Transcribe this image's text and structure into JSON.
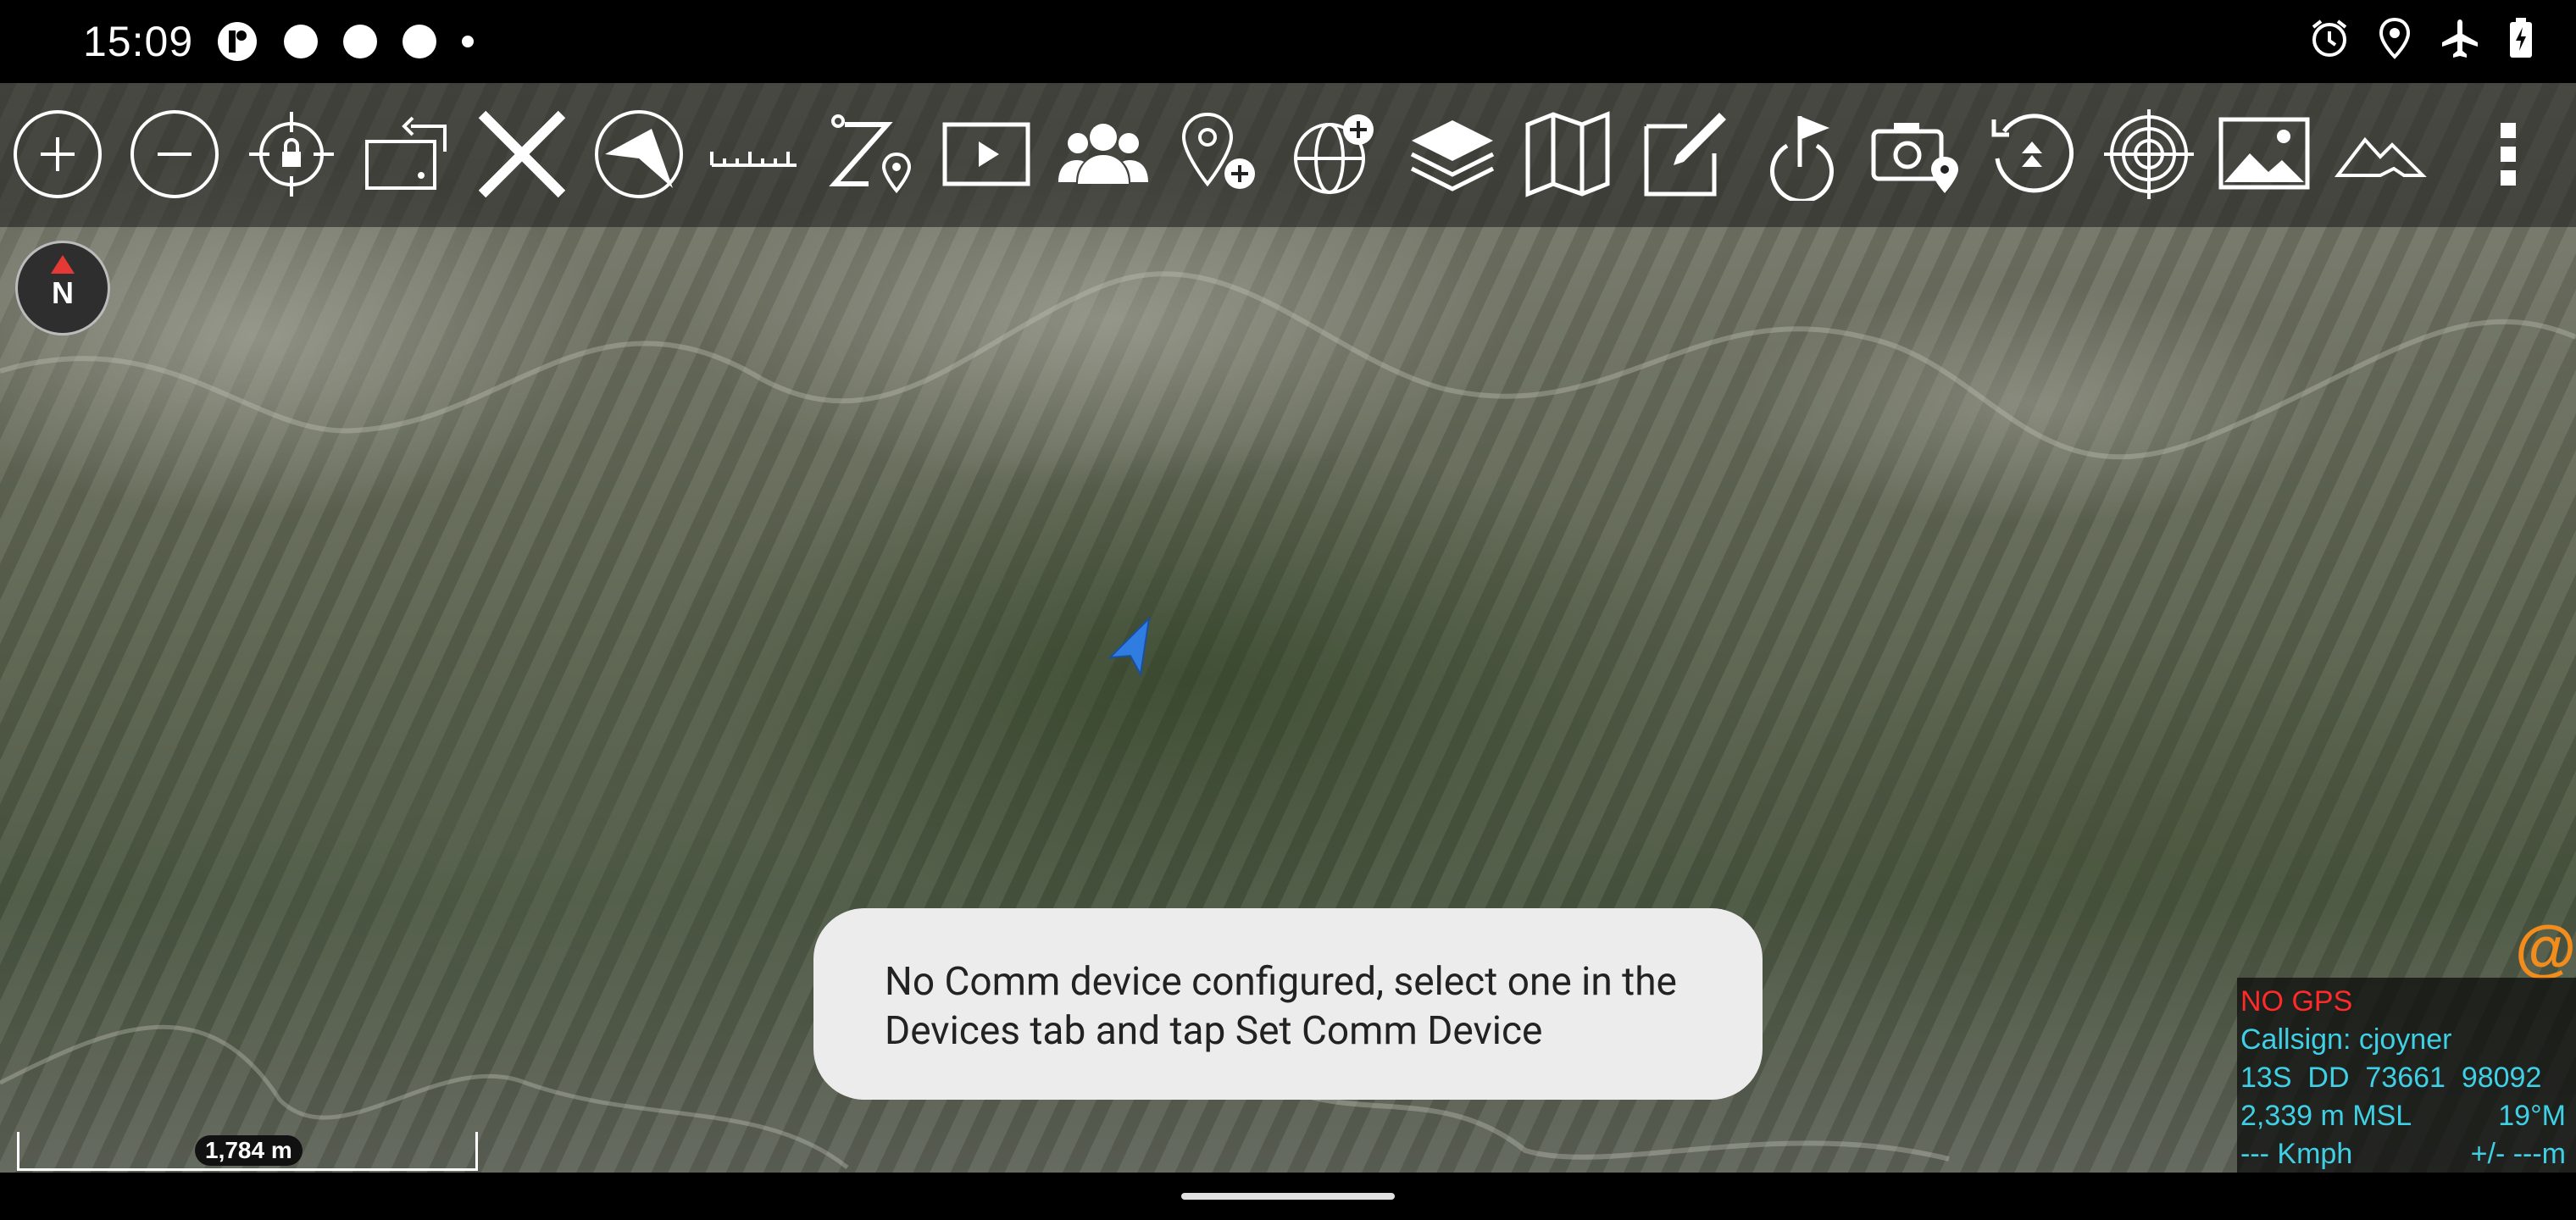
{
  "status_bar": {
    "time": "15:09",
    "left_icons": [
      "app-notification-icon",
      "circle-icon",
      "circle-icon",
      "circle-icon",
      "more-dot-icon"
    ],
    "right_icons": [
      "alarm-icon",
      "location-icon",
      "airplane-icon",
      "battery-charging-icon"
    ]
  },
  "toolbar": {
    "tools": [
      "zoom-in-icon",
      "zoom-out-icon",
      "lock-on-self-icon",
      "rotate-map-icon",
      "x-mark-icon",
      "compass-rose-icon",
      "measure-ruler-icon",
      "route-icon",
      "video-player-icon",
      "contacts-group-icon",
      "add-point-icon",
      "add-overlay-globe-icon",
      "layers-icon",
      "map-icon",
      "edit-note-icon",
      "checkpoint-flag-icon",
      "geotag-camera-icon",
      "track-history-icon",
      "target-icon",
      "image-gallery-icon",
      "terrain-icon",
      "overflow-menu-icon"
    ]
  },
  "compass": {
    "label": "N"
  },
  "toast": {
    "message": "No Comm device configured, select one in the Devices tab and tap Set Comm Device"
  },
  "info_panel": {
    "gps_status": "NO GPS",
    "callsign": "Callsign: cjoyner",
    "mgrs": "13S  DD  73661  98092",
    "altitude": "2,339 m MSL",
    "heading": "19°M",
    "speed": "--- Kmph",
    "accuracy": "+/- ---m"
  },
  "scale_bar": {
    "label": "1,784 m"
  },
  "colors": {
    "accent_cyan": "#3fd0e6",
    "no_gps_red": "#ff2a2a",
    "at_orange": "#f28c1c",
    "self_arrow_blue": "#2f7de1"
  }
}
